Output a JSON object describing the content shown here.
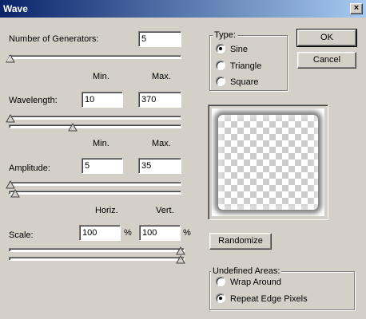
{
  "window": {
    "title": "Wave",
    "close_symbol": "×"
  },
  "generators": {
    "label": "Number of Generators:",
    "value": "5",
    "slider_fraction": 0.0
  },
  "headers_1": {
    "min": "Min.",
    "max": "Max."
  },
  "wavelength": {
    "label": "Wavelength:",
    "min": "10",
    "max": "370",
    "min_slider_fraction": 0.0,
    "max_slider_fraction": 0.37
  },
  "headers_2": {
    "min": "Min.",
    "max": "Max."
  },
  "amplitude": {
    "label": "Amplitude:",
    "min": "5",
    "max": "35",
    "min_slider_fraction": 0.0,
    "max_slider_fraction": 0.03
  },
  "headers_3": {
    "horiz": "Horiz.",
    "vert": "Vert."
  },
  "scale": {
    "label": "Scale:",
    "horiz": "100",
    "vert": "100",
    "percent": "%",
    "horiz_slider_fraction": 1.0,
    "vert_slider_fraction": 1.0
  },
  "type_group": {
    "title": "Type:",
    "options": [
      "Sine",
      "Triangle",
      "Square"
    ],
    "selected": "Sine"
  },
  "buttons": {
    "ok": "OK",
    "cancel": "Cancel",
    "randomize": "Randomize"
  },
  "undefined_group": {
    "title": "Undefined Areas:",
    "options": [
      "Wrap Around",
      "Repeat Edge Pixels"
    ],
    "selected": "Repeat Edge Pixels"
  }
}
